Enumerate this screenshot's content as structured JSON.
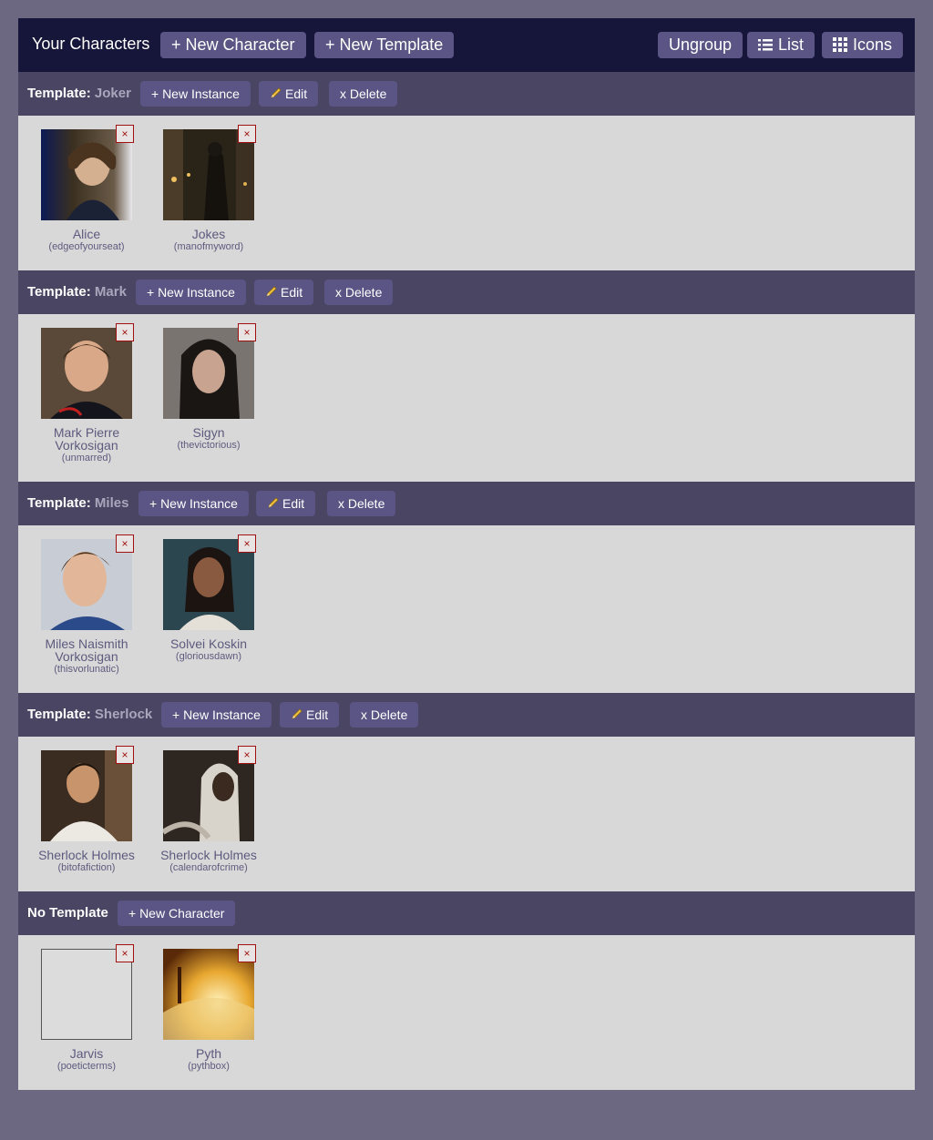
{
  "header": {
    "title": "Your Characters",
    "new_character_label": "+ New Character",
    "new_template_label": "+ New Template",
    "ungroup_label": "Ungroup",
    "list_label": "List",
    "icons_label": "Icons"
  },
  "labels": {
    "template_prefix": "Template:",
    "new_instance": "+ New Instance",
    "edit": "Edit",
    "delete": "x Delete",
    "remove": "×",
    "no_template": "No Template",
    "new_character": "+ New Character"
  },
  "groups": [
    {
      "template": "Joker",
      "characters": [
        {
          "name": "Alice",
          "user": "(edgeofyourseat)",
          "avatar": "portrait-curly-hair"
        },
        {
          "name": "Jokes",
          "user": "(manofmyword)",
          "avatar": "dark-city-street"
        }
      ]
    },
    {
      "template": "Mark",
      "characters": [
        {
          "name": "Mark Pierre Vorkosigan",
          "user": "(unmarred)",
          "avatar": "portrait-uniform"
        },
        {
          "name": "Sigyn",
          "user": "(thevictorious)",
          "avatar": "portrait-dark-hair"
        }
      ]
    },
    {
      "template": "Miles",
      "characters": [
        {
          "name": "Miles Naismith Vorkosigan",
          "user": "(thisvorlunatic)",
          "avatar": "portrait-smiling"
        },
        {
          "name": "Solvei Koskin",
          "user": "(gloriousdawn)",
          "avatar": "portrait-braid"
        }
      ]
    },
    {
      "template": "Sherlock",
      "characters": [
        {
          "name": "Sherlock Holmes",
          "user": "(bitofafiction)",
          "avatar": "portrait-white-shirt"
        },
        {
          "name": "Sherlock Holmes",
          "user": "(calendarofcrime)",
          "avatar": "portrait-hooded"
        }
      ]
    }
  ],
  "no_template": {
    "characters": [
      {
        "name": "Jarvis",
        "user": "(poeticterms)",
        "avatar": "blank"
      },
      {
        "name": "Pyth",
        "user": "(pythbox)",
        "avatar": "open-book"
      }
    ]
  },
  "colors": {
    "page_bg": "#6c6882",
    "topbar_bg": "#16153a",
    "section_head_bg": "#4a4563",
    "section_body_bg": "#d8d8d8",
    "button_bg": "#5a5585",
    "accent_text": "#5e5a7e",
    "remove_red": "#a01010"
  }
}
